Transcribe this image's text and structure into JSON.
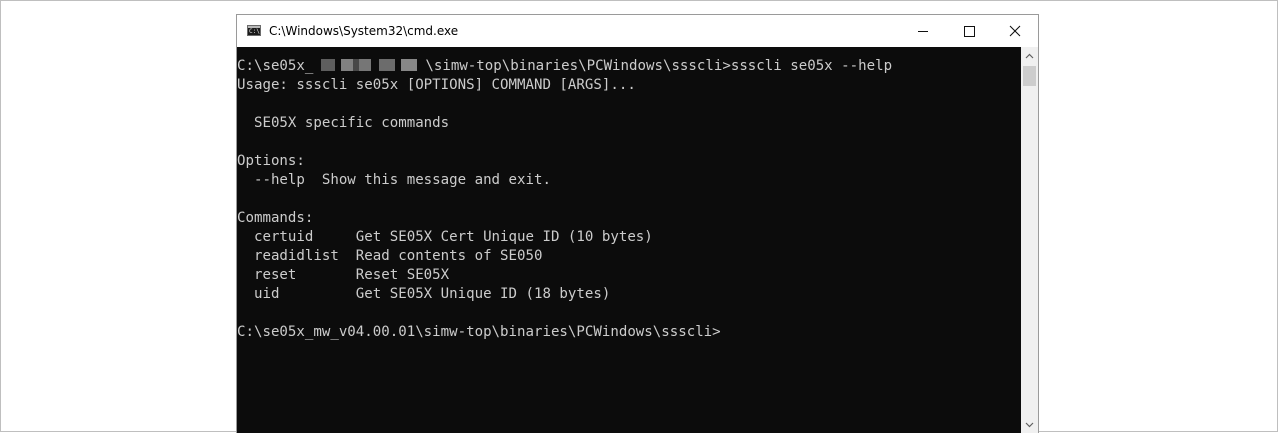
{
  "window": {
    "title": "C:\\Windows\\System32\\cmd.exe",
    "app_icon_text": "C:\\"
  },
  "console": {
    "lines": [
      {
        "before_redaction": "C:\\se05x_",
        "after_redaction": "\\simw-top\\binaries\\PCWindows\\ssscli>ssscli se05x --help"
      },
      "Usage: ssscli se05x [OPTIONS] COMMAND [ARGS]...",
      "",
      "  SE05X specific commands",
      "",
      "Options:",
      "  --help  Show this message and exit.",
      "",
      "Commands:",
      "  certuid     Get SE05X Cert Unique ID (10 bytes)",
      "  readidlist  Read contents of SE050",
      "  reset       Reset SE05X",
      "  uid         Get SE05X Unique ID (18 bytes)",
      "",
      "C:\\se05x_mw_v04.00.01\\simw-top\\binaries\\PCWindows\\ssscli>"
    ]
  },
  "colors": {
    "console_background": "#0c0c0c",
    "console_text": "#cccccc",
    "titlebar_background": "#ffffff"
  },
  "icons": {
    "app": "cmd-icon",
    "minimize": "minimize-icon",
    "maximize": "maximize-icon",
    "close": "close-icon",
    "scroll_up": "scroll-up-arrow-icon",
    "scroll_down": "scroll-down-arrow-icon"
  }
}
